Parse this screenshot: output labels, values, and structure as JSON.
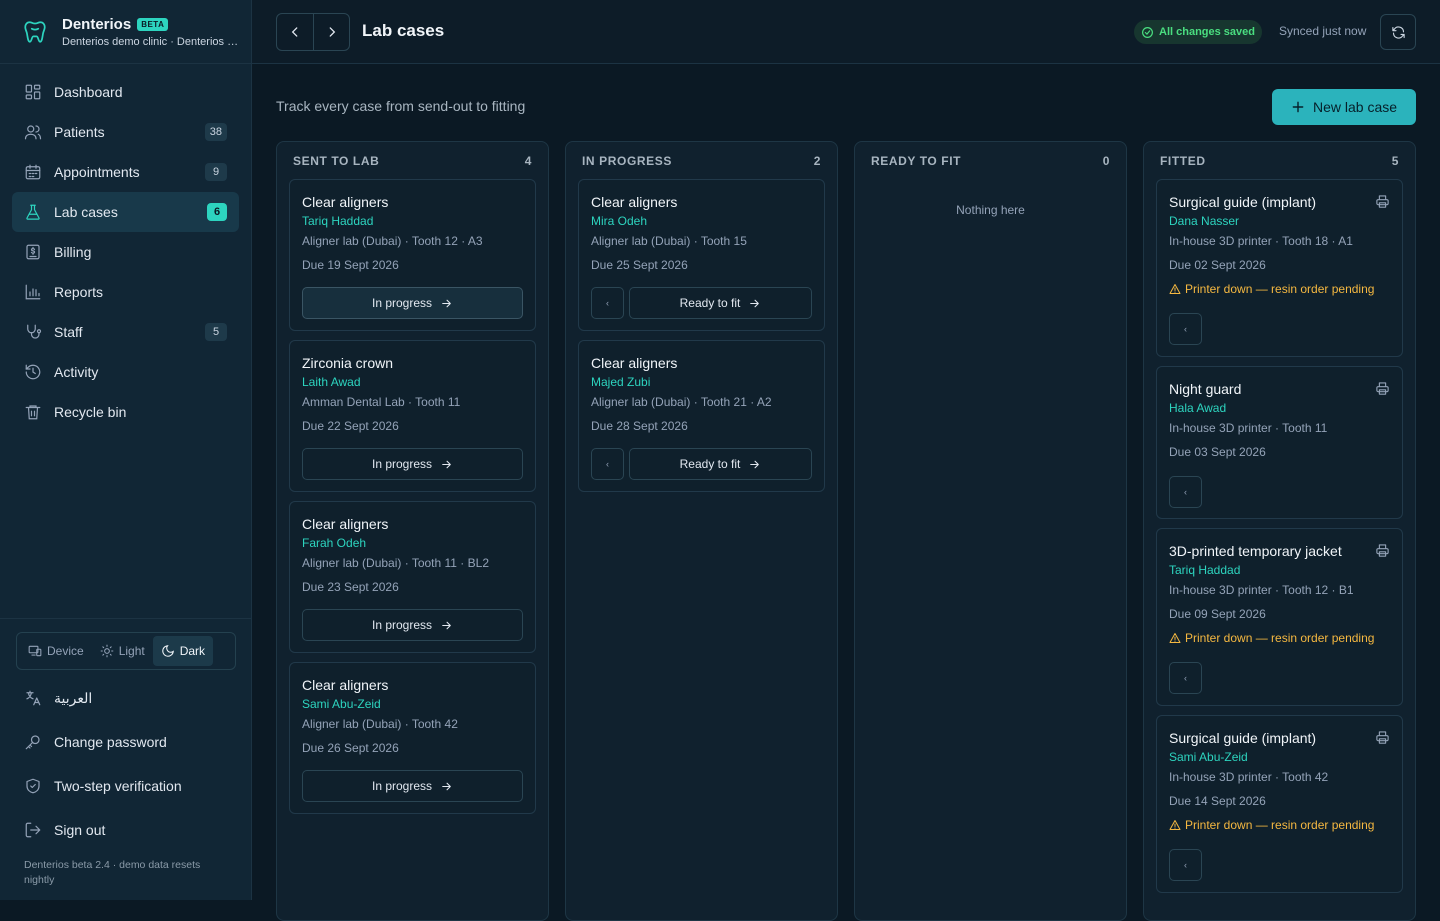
{
  "brand": {
    "name": "Denterios",
    "badge": "BETA",
    "clinic": "Denterios demo clinic · Denterios Dental"
  },
  "nav": [
    {
      "label": "Dashboard",
      "icon": "dashboard-icon",
      "badge": null
    },
    {
      "label": "Patients",
      "icon": "users-icon",
      "badge": "38"
    },
    {
      "label": "Appointments",
      "icon": "calendar-icon",
      "badge": "9"
    },
    {
      "label": "Lab cases",
      "icon": "flask-icon",
      "badge": "6",
      "active": true
    },
    {
      "label": "Billing",
      "icon": "receipt-icon",
      "badge": null
    },
    {
      "label": "Reports",
      "icon": "bar-chart-icon",
      "badge": null
    },
    {
      "label": "Staff",
      "icon": "stethoscope-icon",
      "badge": "5"
    },
    {
      "label": "Activity",
      "icon": "history-icon",
      "badge": null
    },
    {
      "label": "Recycle bin",
      "icon": "trash-icon",
      "badge": null
    }
  ],
  "theme": {
    "device": "Device",
    "light": "Light",
    "dark": "Dark",
    "selected": "Dark"
  },
  "account": {
    "language": "العربية",
    "change_password": "Change password",
    "two_step": "Two-step verification",
    "sign_out": "Sign out"
  },
  "footer": "Denterios beta 2.4 · demo data resets nightly",
  "header": {
    "title": "Lab cases",
    "saved": "All changes saved",
    "synced": "Synced just now"
  },
  "page": {
    "subtitle": "Track every case from send-out to fitting",
    "new_button": "New lab case"
  },
  "columns": [
    {
      "title": "SENT TO LAB",
      "count": "4",
      "cards": [
        {
          "title": "Clear aligners",
          "patient": "Tariq Haddad",
          "lab": "Aligner lab (Dubai) · Tooth 12 · A3",
          "due": "Due 19 Sept 2026",
          "action": "In progress"
        },
        {
          "title": "Zirconia crown",
          "patient": "Laith Awad",
          "lab": "Amman Dental Lab · Tooth 11",
          "due": "Due 22 Sept 2026",
          "action": "In progress"
        },
        {
          "title": "Clear aligners",
          "patient": "Farah Odeh",
          "lab": "Aligner lab (Dubai) · Tooth 11 · BL2",
          "due": "Due 23 Sept 2026",
          "action": "In progress"
        },
        {
          "title": "Clear aligners",
          "patient": "Sami Abu-Zeid",
          "lab": "Aligner lab (Dubai) · Tooth 42",
          "due": "Due 26 Sept 2026",
          "action": "In progress"
        }
      ]
    },
    {
      "title": "IN PROGRESS",
      "count": "2",
      "cards": [
        {
          "title": "Clear aligners",
          "patient": "Mira Odeh",
          "lab": "Aligner lab (Dubai) · Tooth 15",
          "due": "Due 25 Sept 2026",
          "action": "Ready to fit",
          "back": "‹"
        },
        {
          "title": "Clear aligners",
          "patient": "Majed Zubi",
          "lab": "Aligner lab (Dubai) · Tooth 21 · A2",
          "due": "Due 28 Sept 2026",
          "action": "Ready to fit",
          "back": "‹"
        }
      ]
    },
    {
      "title": "READY TO FIT",
      "count": "0",
      "empty": "Nothing here",
      "cards": []
    },
    {
      "title": "FITTED",
      "count": "5",
      "cards": [
        {
          "title": "Surgical guide (implant)",
          "patient": "Dana Nasser",
          "lab": "In-house 3D printer · Tooth 18 · A1",
          "due": "Due 02 Sept 2026",
          "warning": "Printer down — resin order pending",
          "back": "‹"
        },
        {
          "title": "Night guard",
          "patient": "Hala Awad",
          "lab": "In-house 3D printer · Tooth 11",
          "due": "Due 03 Sept 2026",
          "back": "‹"
        },
        {
          "title": "3D-printed temporary jacket",
          "patient": "Tariq Haddad",
          "lab": "In-house 3D printer · Tooth 12 · B1",
          "due": "Due 09 Sept 2026",
          "warning": "Printer down — resin order pending",
          "back": "‹"
        },
        {
          "title": "Surgical guide (implant)",
          "patient": "Sami Abu-Zeid",
          "lab": "In-house 3D printer · Tooth 42",
          "due": "Due 14 Sept 2026",
          "warning": "Printer down — resin order pending",
          "back": "‹"
        }
      ]
    }
  ]
}
